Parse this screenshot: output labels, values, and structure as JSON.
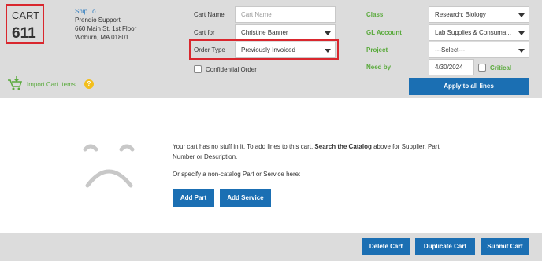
{
  "cart": {
    "label": "CART",
    "number": "611"
  },
  "ship_to": {
    "label": "Ship To",
    "lines": [
      "Prendio Support",
      "660 Main St, 1st Floor",
      "Woburn, MA 01801"
    ]
  },
  "import": {
    "label": "Import Cart Items",
    "help": "?"
  },
  "form": {
    "cart_name": {
      "label": "Cart Name",
      "placeholder": "Cart Name",
      "value": ""
    },
    "cart_for": {
      "label": "Cart for",
      "value": "Christine Banner"
    },
    "order_type": {
      "label": "Order Type",
      "value": "Previously Invoiced"
    },
    "confidential": {
      "label": "Confidential Order",
      "checked": false
    },
    "class": {
      "label": "Class",
      "value": "Research: Biology"
    },
    "gl_account": {
      "label": "GL Account",
      "value": "Lab Supplies & Consuma..."
    },
    "project": {
      "label": "Project",
      "value": "---Select---"
    },
    "need_by": {
      "label": "Need by",
      "value": "4/30/2024"
    },
    "critical": {
      "label": "Critical",
      "checked": false
    },
    "apply_label": "Apply to all lines"
  },
  "empty_state": {
    "line1_pre": "Your cart has no stuff in it. To add lines to this cart, ",
    "line1_bold": "Search the Catalog",
    "line1_post": " above for Supplier, Part",
    "line2": "Number or Description.",
    "line3": "Or specify a non-catalog Part or Service here:",
    "add_part": "Add Part",
    "add_service": "Add Service"
  },
  "footer": {
    "delete": "Delete Cart",
    "duplicate": "Duplicate Cart",
    "submit": "Submit Cart"
  },
  "colors": {
    "accent_blue": "#1b6fb3",
    "highlight_red": "#d9272e",
    "label_green": "#5aaa3c",
    "header_gray": "#dcdcdc"
  }
}
